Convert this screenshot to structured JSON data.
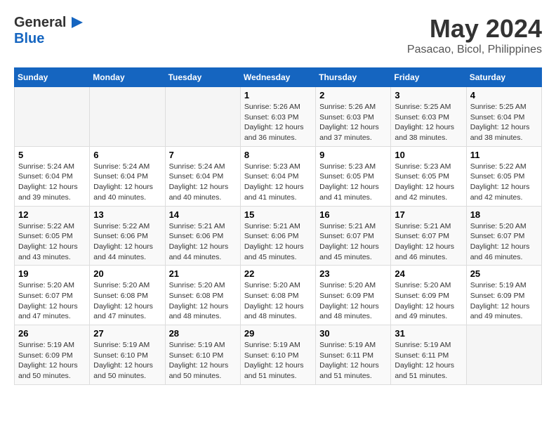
{
  "logo": {
    "general": "General",
    "blue": "Blue"
  },
  "title": "May 2024",
  "subtitle": "Pasacao, Bicol, Philippines",
  "days_header": [
    "Sunday",
    "Monday",
    "Tuesday",
    "Wednesday",
    "Thursday",
    "Friday",
    "Saturday"
  ],
  "weeks": [
    {
      "cells": [
        {
          "day": null,
          "info": null
        },
        {
          "day": null,
          "info": null
        },
        {
          "day": null,
          "info": null
        },
        {
          "day": "1",
          "info": "Sunrise: 5:26 AM\nSunset: 6:03 PM\nDaylight: 12 hours and 36 minutes."
        },
        {
          "day": "2",
          "info": "Sunrise: 5:26 AM\nSunset: 6:03 PM\nDaylight: 12 hours and 37 minutes."
        },
        {
          "day": "3",
          "info": "Sunrise: 5:25 AM\nSunset: 6:03 PM\nDaylight: 12 hours and 38 minutes."
        },
        {
          "day": "4",
          "info": "Sunrise: 5:25 AM\nSunset: 6:04 PM\nDaylight: 12 hours and 38 minutes."
        }
      ]
    },
    {
      "cells": [
        {
          "day": "5",
          "info": "Sunrise: 5:24 AM\nSunset: 6:04 PM\nDaylight: 12 hours and 39 minutes."
        },
        {
          "day": "6",
          "info": "Sunrise: 5:24 AM\nSunset: 6:04 PM\nDaylight: 12 hours and 40 minutes."
        },
        {
          "day": "7",
          "info": "Sunrise: 5:24 AM\nSunset: 6:04 PM\nDaylight: 12 hours and 40 minutes."
        },
        {
          "day": "8",
          "info": "Sunrise: 5:23 AM\nSunset: 6:04 PM\nDaylight: 12 hours and 41 minutes."
        },
        {
          "day": "9",
          "info": "Sunrise: 5:23 AM\nSunset: 6:05 PM\nDaylight: 12 hours and 41 minutes."
        },
        {
          "day": "10",
          "info": "Sunrise: 5:23 AM\nSunset: 6:05 PM\nDaylight: 12 hours and 42 minutes."
        },
        {
          "day": "11",
          "info": "Sunrise: 5:22 AM\nSunset: 6:05 PM\nDaylight: 12 hours and 42 minutes."
        }
      ]
    },
    {
      "cells": [
        {
          "day": "12",
          "info": "Sunrise: 5:22 AM\nSunset: 6:05 PM\nDaylight: 12 hours and 43 minutes."
        },
        {
          "day": "13",
          "info": "Sunrise: 5:22 AM\nSunset: 6:06 PM\nDaylight: 12 hours and 44 minutes."
        },
        {
          "day": "14",
          "info": "Sunrise: 5:21 AM\nSunset: 6:06 PM\nDaylight: 12 hours and 44 minutes."
        },
        {
          "day": "15",
          "info": "Sunrise: 5:21 AM\nSunset: 6:06 PM\nDaylight: 12 hours and 45 minutes."
        },
        {
          "day": "16",
          "info": "Sunrise: 5:21 AM\nSunset: 6:07 PM\nDaylight: 12 hours and 45 minutes."
        },
        {
          "day": "17",
          "info": "Sunrise: 5:21 AM\nSunset: 6:07 PM\nDaylight: 12 hours and 46 minutes."
        },
        {
          "day": "18",
          "info": "Sunrise: 5:20 AM\nSunset: 6:07 PM\nDaylight: 12 hours and 46 minutes."
        }
      ]
    },
    {
      "cells": [
        {
          "day": "19",
          "info": "Sunrise: 5:20 AM\nSunset: 6:07 PM\nDaylight: 12 hours and 47 minutes."
        },
        {
          "day": "20",
          "info": "Sunrise: 5:20 AM\nSunset: 6:08 PM\nDaylight: 12 hours and 47 minutes."
        },
        {
          "day": "21",
          "info": "Sunrise: 5:20 AM\nSunset: 6:08 PM\nDaylight: 12 hours and 48 minutes."
        },
        {
          "day": "22",
          "info": "Sunrise: 5:20 AM\nSunset: 6:08 PM\nDaylight: 12 hours and 48 minutes."
        },
        {
          "day": "23",
          "info": "Sunrise: 5:20 AM\nSunset: 6:09 PM\nDaylight: 12 hours and 48 minutes."
        },
        {
          "day": "24",
          "info": "Sunrise: 5:20 AM\nSunset: 6:09 PM\nDaylight: 12 hours and 49 minutes."
        },
        {
          "day": "25",
          "info": "Sunrise: 5:19 AM\nSunset: 6:09 PM\nDaylight: 12 hours and 49 minutes."
        }
      ]
    },
    {
      "cells": [
        {
          "day": "26",
          "info": "Sunrise: 5:19 AM\nSunset: 6:09 PM\nDaylight: 12 hours and 50 minutes."
        },
        {
          "day": "27",
          "info": "Sunrise: 5:19 AM\nSunset: 6:10 PM\nDaylight: 12 hours and 50 minutes."
        },
        {
          "day": "28",
          "info": "Sunrise: 5:19 AM\nSunset: 6:10 PM\nDaylight: 12 hours and 50 minutes."
        },
        {
          "day": "29",
          "info": "Sunrise: 5:19 AM\nSunset: 6:10 PM\nDaylight: 12 hours and 51 minutes."
        },
        {
          "day": "30",
          "info": "Sunrise: 5:19 AM\nSunset: 6:11 PM\nDaylight: 12 hours and 51 minutes."
        },
        {
          "day": "31",
          "info": "Sunrise: 5:19 AM\nSunset: 6:11 PM\nDaylight: 12 hours and 51 minutes."
        },
        {
          "day": null,
          "info": null
        }
      ]
    }
  ]
}
